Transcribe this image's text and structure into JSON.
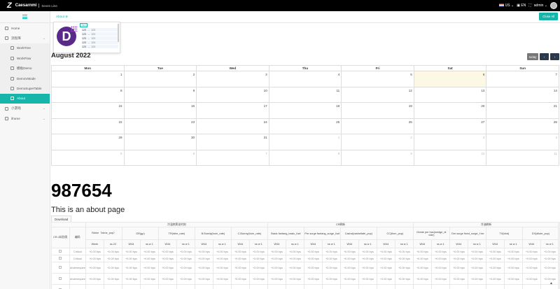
{
  "header": {
    "logo_letter": "Z",
    "brand": "Caesarnmi",
    "subtitle": "Seven Line",
    "region": "US",
    "lang": "EN",
    "user": "admin"
  },
  "sidebar": {
    "items": [
      {
        "label": "Home",
        "level": 1
      },
      {
        "label": "流程库",
        "level": 1,
        "expand": true
      },
      {
        "label": "WorkTree",
        "level": 2
      },
      {
        "label": "WorkFlow",
        "level": 2
      },
      {
        "label": "模板Demo",
        "level": 2
      },
      {
        "label": "DemoVMode",
        "level": 2
      },
      {
        "label": "DemoSuperTable",
        "level": 2
      },
      {
        "label": "About",
        "level": 2,
        "active": true
      },
      {
        "label": "小游戏",
        "level": 1,
        "expand": true
      },
      {
        "label": "iframe",
        "level": 1,
        "expand": true
      }
    ]
  },
  "tabs": {
    "active": "About ⊗",
    "close_all": "Close All"
  },
  "popup": {
    "tag": "TAG",
    "rows": [
      {
        "a": "123",
        "b": "123"
      },
      {
        "a": "123",
        "b": "123"
      },
      {
        "a": "123",
        "b": "123"
      },
      {
        "a": "123",
        "b": "123"
      },
      {
        "a": "123",
        "b": "123"
      }
    ]
  },
  "calendar": {
    "title": "August 2022",
    "today_label": "today",
    "prev": "‹",
    "next": "›",
    "days": [
      "Mon",
      "Tue",
      "Wed",
      "Thu",
      "Fri",
      "Sat",
      "Sun"
    ],
    "weeks": [
      [
        "1",
        "2",
        "3",
        "4",
        "5",
        "6",
        "7"
      ],
      [
        "8",
        "9",
        "10",
        "11",
        "12",
        "13",
        "14"
      ],
      [
        "15",
        "16",
        "17",
        "18",
        "19",
        "20",
        "21"
      ],
      [
        "22",
        "23",
        "24",
        "25",
        "26",
        "27",
        "28"
      ],
      [
        "29",
        "30",
        "31",
        "1",
        "2",
        "3",
        "4"
      ],
      [
        "5",
        "6",
        "7",
        "8",
        "9",
        "10",
        "11"
      ]
    ]
  },
  "big_number": "987654",
  "about_text": "This is an about page",
  "download_label": "Download",
  "grid": {
    "groups": [
      "",
      "冷温热氧化时刻",
      "CR刷新",
      "冷油刷新"
    ],
    "fields": [
      "CR-1料别类",
      "编码",
      "Rdme（rdme_pop）",
      "GR(gp)",
      "TR(tdire_rate)",
      "B.Burrdy(burn_rate)",
      "C.Burrzy(burn_rate)",
      "Basic fantang_basic_fuel",
      "Pre surge fantang_surge_fuel",
      "Cashd(casheltafe_pop)",
      "CC(flom_pop)",
      "Divide per trac(wedge_di vide)",
      "Dre surge fixed_surge_f ixe",
      "TX(tdrd)",
      "DX(dilute_pop)"
    ],
    "subs": [
      "Week",
      "ss 22",
      "W44",
      "ss w 1"
    ],
    "rows": [
      {
        "cat": "Critical",
        "tall": false
      },
      {
        "cat": "Critical",
        "tall": false
      },
      {
        "cat": "Underrequire",
        "tall": true
      },
      {
        "cat": "Underrequire",
        "tall": true
      },
      {
        "cat": "Underrequire",
        "tall": true
      }
    ],
    "cell": "+0.00 bps"
  },
  "scroll_top": "▲"
}
